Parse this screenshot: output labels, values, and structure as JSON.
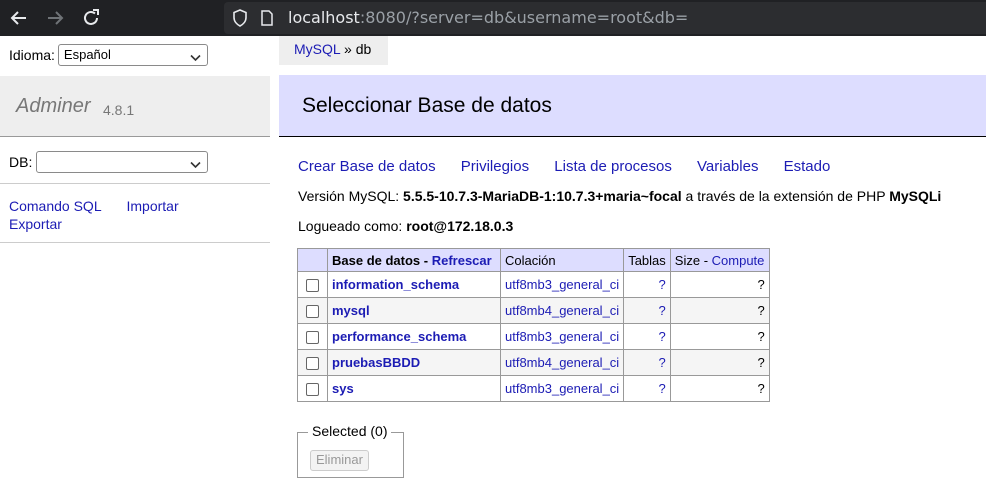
{
  "browser": {
    "url_host": "localhost",
    "url_rest": ":8080/?server=db&username=root&db="
  },
  "sidebar": {
    "language_label": "Idioma:",
    "language_selected": "Español",
    "app_name": "Adminer",
    "app_version": "4.8.1",
    "db_label": "DB:",
    "db_selected": "",
    "links": {
      "sql_command": "Comando SQL",
      "import": "Importar",
      "export": "Exportar"
    }
  },
  "breadcrumb": {
    "root": "MySQL",
    "separator": "»",
    "current": "db"
  },
  "main": {
    "title": "Seleccionar Base de datos",
    "actions": [
      "Crear Base de datos",
      "Privilegios",
      "Lista de procesos",
      "Variables",
      "Estado"
    ],
    "version_prefix": "Versión MySQL:",
    "version_value": "5.5.5-10.7.3-MariaDB-1:10.7.3+maria~focal",
    "version_suffix": "a través de la extensión de PHP",
    "php_extension": "MySQLi",
    "logged_prefix": "Logueado como:",
    "logged_value": "root@172.18.0.3"
  },
  "table": {
    "headers": {
      "database": "Base de datos",
      "separator": " - ",
      "refresh": "Refrescar",
      "collation": "Colación",
      "tables": "Tablas",
      "size": "Size",
      "compute": "Compute"
    },
    "rows": [
      {
        "name": "information_schema",
        "collation": "utf8mb3_general_ci",
        "tables": "?",
        "size": "?"
      },
      {
        "name": "mysql",
        "collation": "utf8mb4_general_ci",
        "tables": "?",
        "size": "?"
      },
      {
        "name": "performance_schema",
        "collation": "utf8mb3_general_ci",
        "tables": "?",
        "size": "?"
      },
      {
        "name": "pruebasBBDD",
        "collation": "utf8mb4_general_ci",
        "tables": "?",
        "size": "?"
      },
      {
        "name": "sys",
        "collation": "utf8mb3_general_ci",
        "tables": "?",
        "size": "?"
      }
    ]
  },
  "selection": {
    "legend": "Selected (0)",
    "delete_button": "Eliminar"
  },
  "colors": {
    "chrome": "#202124",
    "accent_band": "#ddddff",
    "link": "#1c1cb4"
  }
}
